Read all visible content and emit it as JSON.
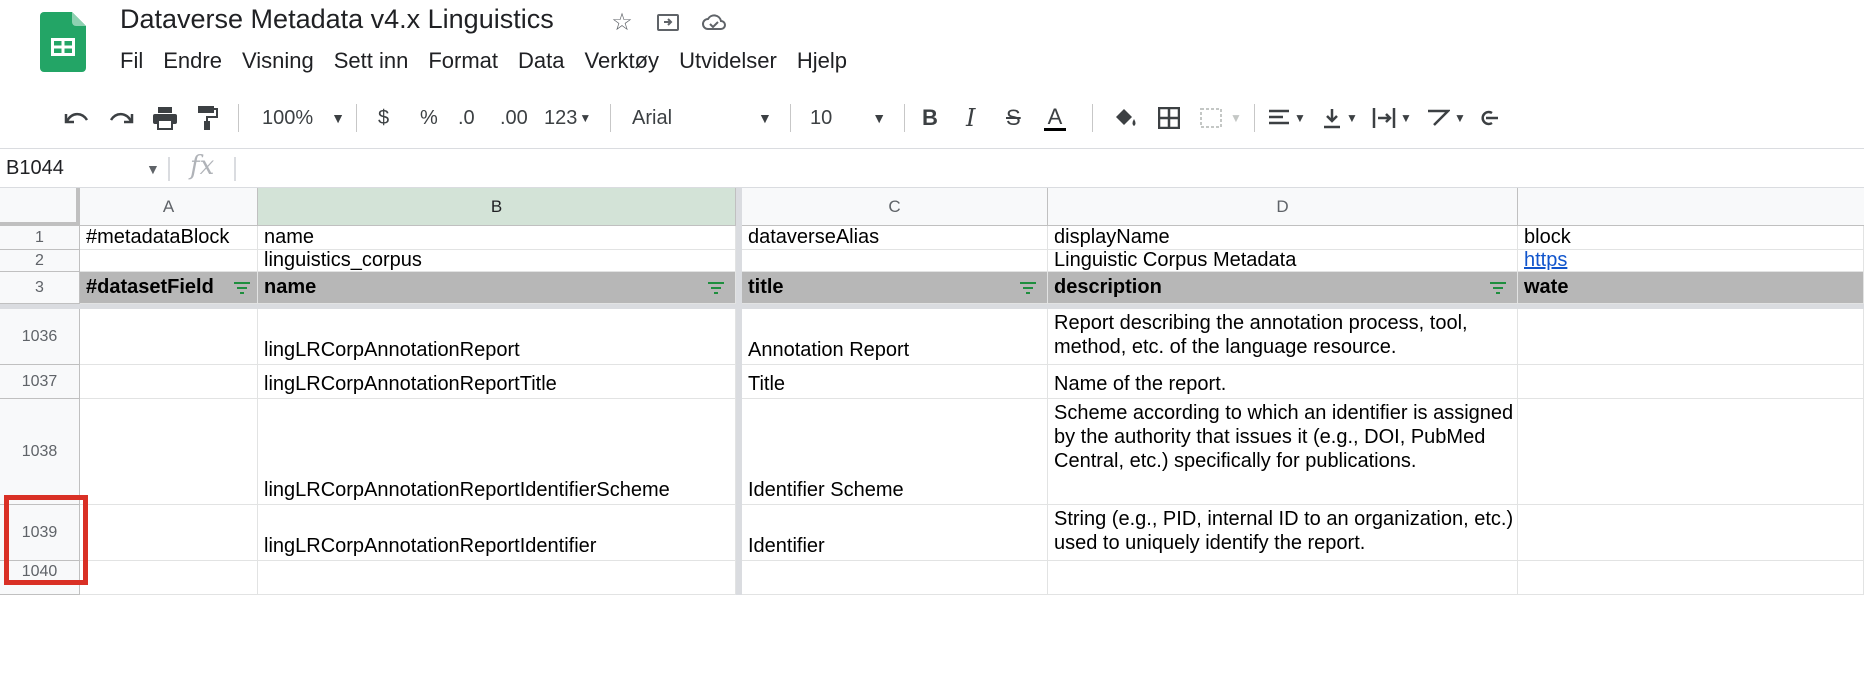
{
  "app": {
    "title": "Dataverse Metadata v4.x Linguistics",
    "logo_icon": "sheets-logo-icon",
    "accent_color": "#1fa463"
  },
  "menu": [
    "Fil",
    "Endre",
    "Visning",
    "Sett inn",
    "Format",
    "Data",
    "Verktøy",
    "Utvidelser",
    "Hjelp"
  ],
  "toolbar": {
    "zoom": "100%",
    "currency": "$",
    "percent": "%",
    "decrease_decimals": ".0",
    "increase_decimals": ".00",
    "more_formats": "123",
    "font": "Arial",
    "font_size": "10",
    "bold": "B",
    "italic": "I",
    "strike": "S",
    "text_color": "A"
  },
  "formula_bar": {
    "cell_ref": "B1044",
    "fx": "fx",
    "value": ""
  },
  "columns": [
    "A",
    "B",
    "C",
    "D"
  ],
  "rows": [
    {
      "num": "1",
      "cells": [
        "#metadataBlock",
        "name",
        "dataverseAlias",
        "displayName",
        "block"
      ]
    },
    {
      "num": "2",
      "cells": [
        "",
        "linguistics_corpus",
        "",
        "Linguistic Corpus Metadata",
        "https"
      ]
    },
    {
      "num": "3",
      "cells": [
        "#datasetField",
        "name",
        "title",
        "description",
        "wate"
      ]
    },
    {
      "num": "1036",
      "cells": [
        "",
        "lingLRCorpAnnotationReport",
        "Annotation Report",
        "Report describing the annotation process, tool, method, etc. of the language resource.",
        ""
      ]
    },
    {
      "num": "1037",
      "cells": [
        "",
        "lingLRCorpAnnotationReportTitle",
        "Title",
        "Name of the report.",
        ""
      ]
    },
    {
      "num": "1038",
      "cells": [
        "",
        "lingLRCorpAnnotationReportIdentifierScheme",
        "Identifier Scheme",
        "Scheme according to which an identifier is assigned by the authority that issues it (e.g., DOI, PubMed Central, etc.) specifically for publications.",
        ""
      ]
    },
    {
      "num": "1039",
      "cells": [
        "",
        "lingLRCorpAnnotationReportIdentifier",
        "Identifier",
        "String (e.g., PID, internal ID to an organization, etc.) used to uniquely identify the report.",
        ""
      ]
    },
    {
      "num": "1040",
      "cells": [
        "",
        "",
        "",
        "",
        ""
      ]
    }
  ],
  "highlight_color": "#d93025",
  "header_row_color": "#b7b7b7"
}
